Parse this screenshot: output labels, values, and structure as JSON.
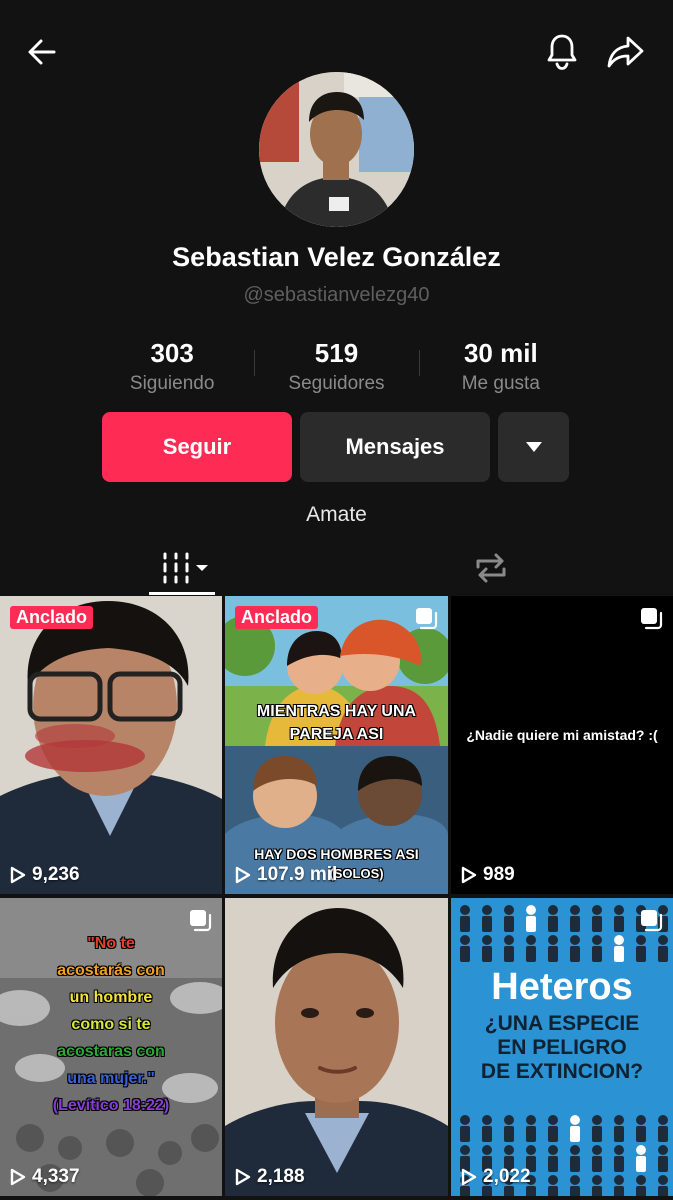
{
  "profile": {
    "name": "Sebastian Velez González",
    "handle": "@sebastianvelezg40",
    "bio": "Amate"
  },
  "stats": [
    {
      "value": "303",
      "label": "Siguiendo"
    },
    {
      "value": "519",
      "label": "Seguidores"
    },
    {
      "value": "30 mil",
      "label": "Me gusta"
    }
  ],
  "actions": {
    "follow_label": "Seguir",
    "message_label": "Mensajes"
  },
  "icons": {
    "back": "arrow-left-icon",
    "bell": "bell-icon",
    "share": "share-icon",
    "more": "caret-down-icon",
    "videos_tab": "grid-videos-icon",
    "reposts_tab": "repost-icon"
  },
  "colors": {
    "accent": "#fe2c55",
    "background": "#121212",
    "button_dark": "#2b2b2b"
  },
  "videos": [
    {
      "views": "9,236",
      "pinned": true,
      "pin_label": "Anclado",
      "multi": false
    },
    {
      "views": "107.9 mil",
      "pinned": true,
      "pin_label": "Anclado",
      "multi": true,
      "top_text": "MIENTRAS HAY UNA PAREJA ASI",
      "bottom_text": "HAY DOS HOMBRES ASI",
      "bottom_text2": "(SOLOS)"
    },
    {
      "views": "989",
      "pinned": false,
      "multi": true,
      "caption": "¿Nadie quiere mi amistad? :("
    },
    {
      "views": "4,337",
      "pinned": false,
      "multi": true,
      "caption_lines": [
        "\"No te",
        "acostarás con",
        "un hombre",
        "como si te",
        "acostaras con",
        "una mujer.\"",
        "(Levítico 18:22)"
      ]
    },
    {
      "views": "2,188",
      "pinned": false,
      "multi": false
    },
    {
      "views": "2,022",
      "pinned": false,
      "multi": true,
      "title": "Heteros",
      "subtitle_lines": [
        "¿UNA ESPECIE",
        "EN PELIGRO",
        "DE EXTINCION?"
      ]
    }
  ]
}
